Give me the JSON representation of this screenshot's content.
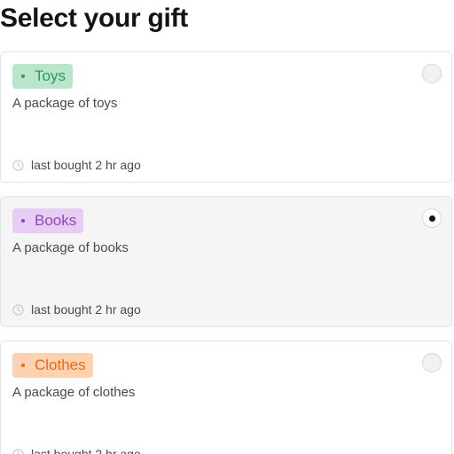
{
  "page": {
    "title": "Select your gift"
  },
  "options": [
    {
      "tag": "Toys",
      "description": "A package of toys",
      "last_bought": "last bought 2 hr ago",
      "selected": false,
      "tag_bg": "#b9e6cb",
      "tag_color": "#2b9a5c"
    },
    {
      "tag": "Books",
      "description": "A package of books",
      "last_bought": "last bought 2 hr ago",
      "selected": true,
      "tag_bg": "#e7cdf4",
      "tag_color": "#9144c4"
    },
    {
      "tag": "Clothes",
      "description": "A package of clothes",
      "last_bought": "last bought 2 hr ago",
      "selected": false,
      "tag_bg": "#fdd2b3",
      "tag_color": "#ee6a11"
    }
  ]
}
